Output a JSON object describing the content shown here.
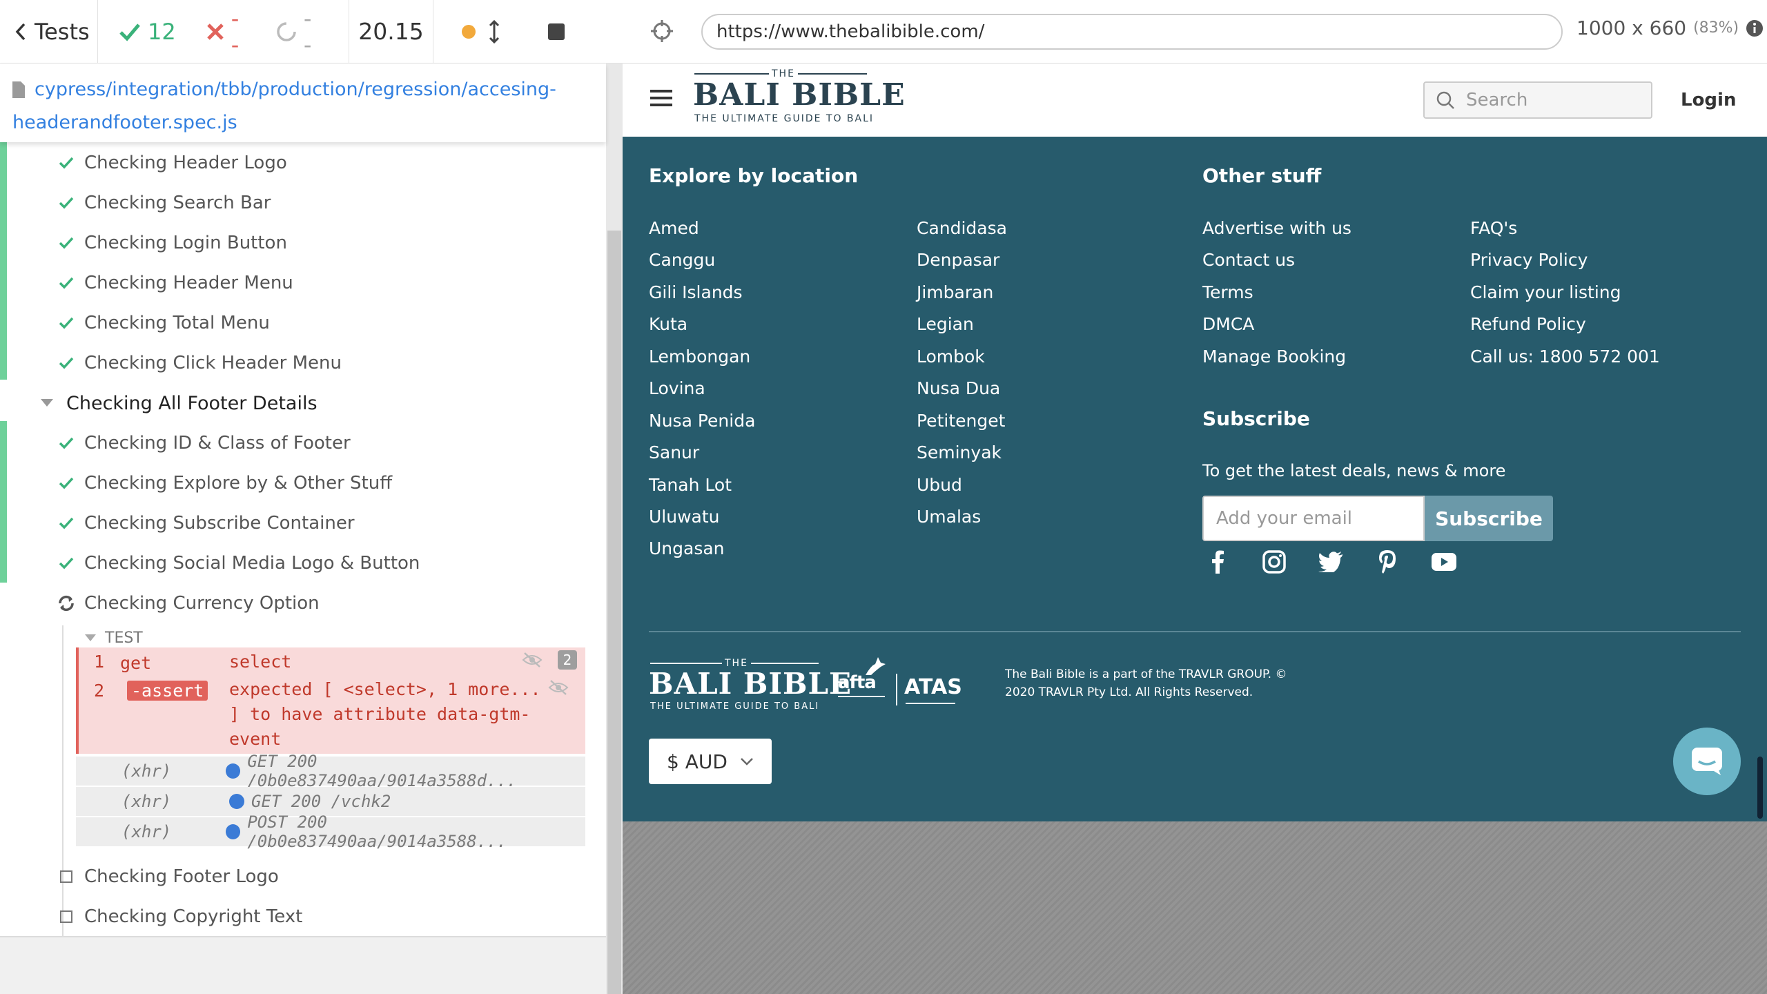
{
  "runner": {
    "back_label": "Tests",
    "passed": "12",
    "failed": "--",
    "pending": "--",
    "duration": "20.15",
    "spec_line1": "cypress/integration/tbb/production/regression/accesing-",
    "spec_line2": "headerandfooter.spec.js",
    "tests": [
      {
        "label": "Checking Header Logo",
        "state": "passed"
      },
      {
        "label": "Checking Search Bar",
        "state": "passed"
      },
      {
        "label": "Checking Login Button",
        "state": "passed"
      },
      {
        "label": "Checking Header Menu",
        "state": "passed"
      },
      {
        "label": "Checking Total Menu",
        "state": "passed"
      },
      {
        "label": "Checking Click Header Menu",
        "state": "passed"
      }
    ],
    "suite_label": "Checking All Footer Details",
    "suite_tests": [
      {
        "label": "Checking ID & Class of Footer",
        "state": "passed"
      },
      {
        "label": "Checking Explore by & Other Stuff",
        "state": "passed"
      },
      {
        "label": "Checking Subscribe Container",
        "state": "passed"
      },
      {
        "label": "Checking Social Media Logo & Button",
        "state": "passed"
      },
      {
        "label": "Checking Currency Option",
        "state": "running"
      }
    ],
    "log_section": "TEST",
    "commands": [
      {
        "num": "1",
        "name": "get",
        "msg": "select",
        "badge": "2"
      },
      {
        "num": "2",
        "name": "-assert",
        "msg_line1": "expected [ <select>, 1 more...",
        "msg_line2": "] to have attribute data-gtm-",
        "msg_line3": "event"
      }
    ],
    "xhr": [
      {
        "label": "(xhr)",
        "msg": "GET 200 /0b0e837490aa/9014a3588d..."
      },
      {
        "label": "(xhr)",
        "msg": "GET 200 /vchk2"
      },
      {
        "label": "(xhr)",
        "msg": "POST 200 /0b0e837490aa/9014a3588..."
      }
    ],
    "pending_tests": [
      {
        "label": "Checking Footer Logo"
      },
      {
        "label": "Checking Copyright Text"
      }
    ]
  },
  "preview": {
    "url": "https://www.thebalibible.com/",
    "viewport": "1000 x 660",
    "scale": "(83%)",
    "site": {
      "logo_the": "THE",
      "logo_main": "BALI BIBLE",
      "logo_tag": "THE ULTIMATE GUIDE TO BALI",
      "search_placeholder": "Search",
      "login_label": "Login",
      "explore_title": "Explore by location",
      "locations_col1": [
        "Amed",
        "Canggu",
        "Gili Islands",
        "Kuta",
        "Lembongan",
        "Lovina",
        "Nusa Penida",
        "Sanur",
        "Tanah Lot",
        "Uluwatu",
        "Ungasan"
      ],
      "locations_col2": [
        "Candidasa",
        "Denpasar",
        "Jimbaran",
        "Legian",
        "Lombok",
        "Nusa Dua",
        "Petitenget",
        "Seminyak",
        "Ubud",
        "Umalas"
      ],
      "other_title": "Other stuff",
      "other_col1": [
        "Advertise with us",
        "Contact us",
        "Terms",
        "DMCA",
        "Manage Booking"
      ],
      "other_col2": [
        "FAQ's",
        "Privacy Policy",
        "Claim your listing",
        "Refund Policy",
        "Call us: 1800 572 001"
      ],
      "subscribe_title": "Subscribe",
      "subscribe_text": "To get the latest deals, news & more",
      "email_placeholder": "Add your email",
      "subscribe_button": "Subscribe",
      "afta_label": "afta",
      "atas_label": "ATAS",
      "copyright_line1": "The Bali Bible is a part of the TRAVLR GROUP. ©",
      "copyright_line2": "2020 TRAVLR Pty Ltd. All Rights Reserved.",
      "currency": "$ AUD"
    }
  },
  "colors": {
    "footer_bg": "#275b6c",
    "pass": "#3ab27a",
    "fail": "#e1625b",
    "link_blue": "#3380e0"
  },
  "icons": [
    "chevron-left-icon",
    "check-icon",
    "x-icon",
    "spinner-icon",
    "orange-dot-icon",
    "resize-icon",
    "stop-icon",
    "crosshair-icon",
    "info-icon",
    "file-icon",
    "hamburger-icon",
    "search-icon",
    "facebook-icon",
    "instagram-icon",
    "twitter-icon",
    "pinterest-icon",
    "youtube-icon",
    "chevron-down-icon",
    "chat-icon",
    "refresh-icon",
    "eye-slash-icon",
    "checkbox-icon"
  ]
}
